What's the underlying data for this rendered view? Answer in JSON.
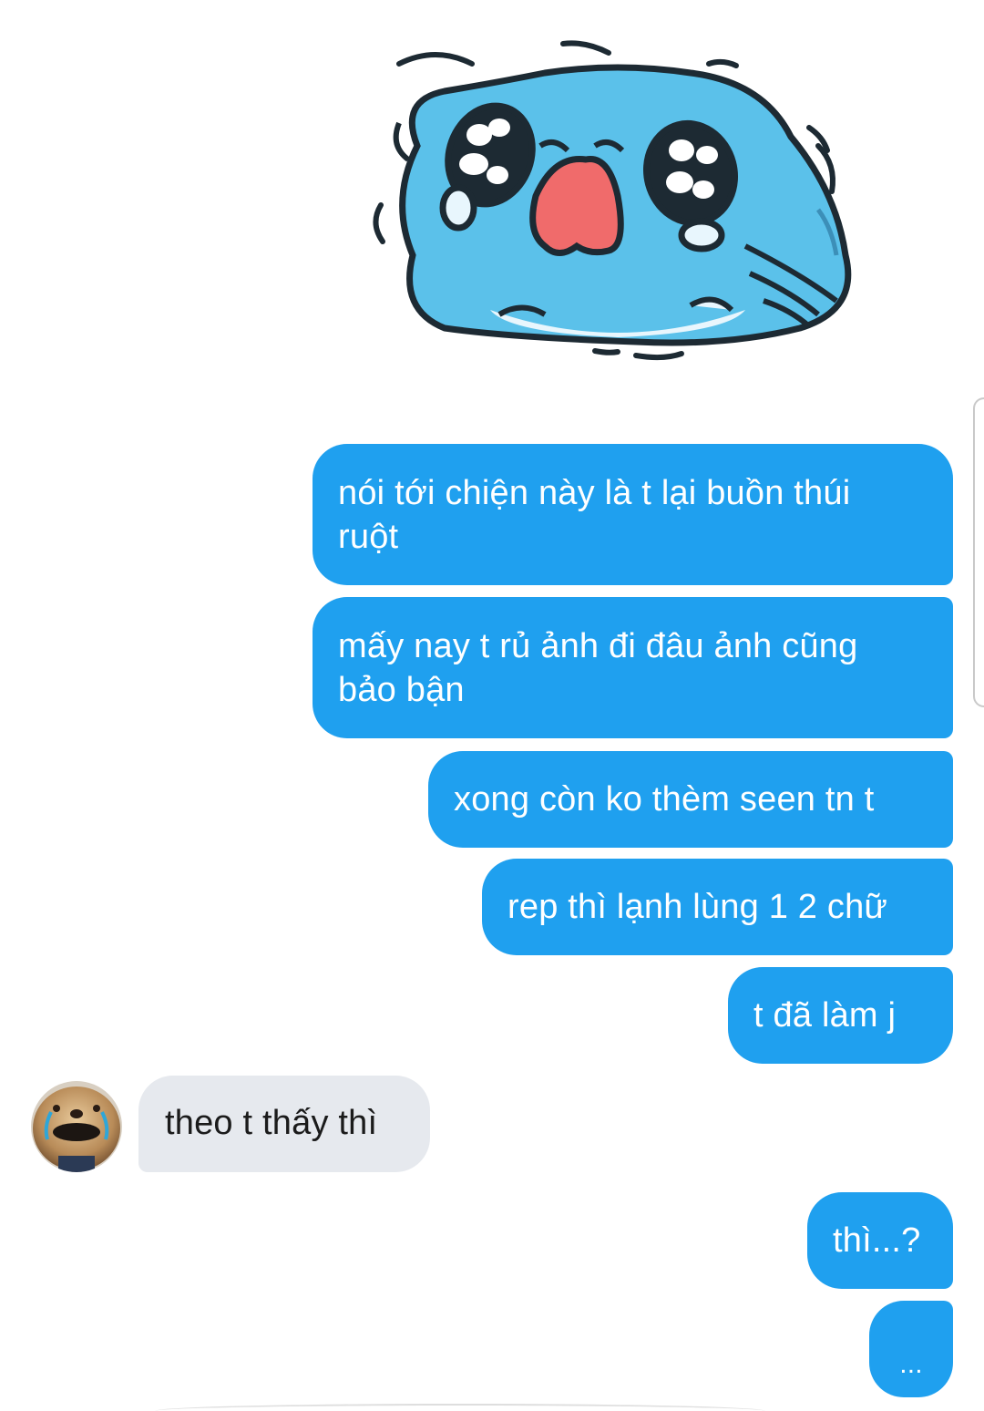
{
  "conversation": {
    "sticker_icon": "crying-blue-blob-sticker-icon",
    "avatar_icon": "crying-dog-avatar-icon",
    "messages": [
      {
        "from": "me",
        "text": "nói tới chiện này là t lại buồn thúi\nruột"
      },
      {
        "from": "me",
        "text": "mấy nay t rủ ảnh đi đâu ảnh cũng\nbảo bận"
      },
      {
        "from": "me",
        "text": "xong còn ko thèm seen tn t"
      },
      {
        "from": "me",
        "text": "rep thì lạnh lùng 1 2 chữ"
      },
      {
        "from": "me",
        "text": "t đã làm j"
      },
      {
        "from": "them",
        "text": "theo t thấy thì"
      },
      {
        "from": "me",
        "text": "thì...?"
      },
      {
        "from": "me",
        "text": "..."
      }
    ]
  },
  "colors": {
    "outgoing_bubble": "#1fa0ef",
    "incoming_bubble": "#e6e9ee",
    "sticker_fill": "#5bc1ea",
    "sticker_mouth": "#f06b6b"
  }
}
